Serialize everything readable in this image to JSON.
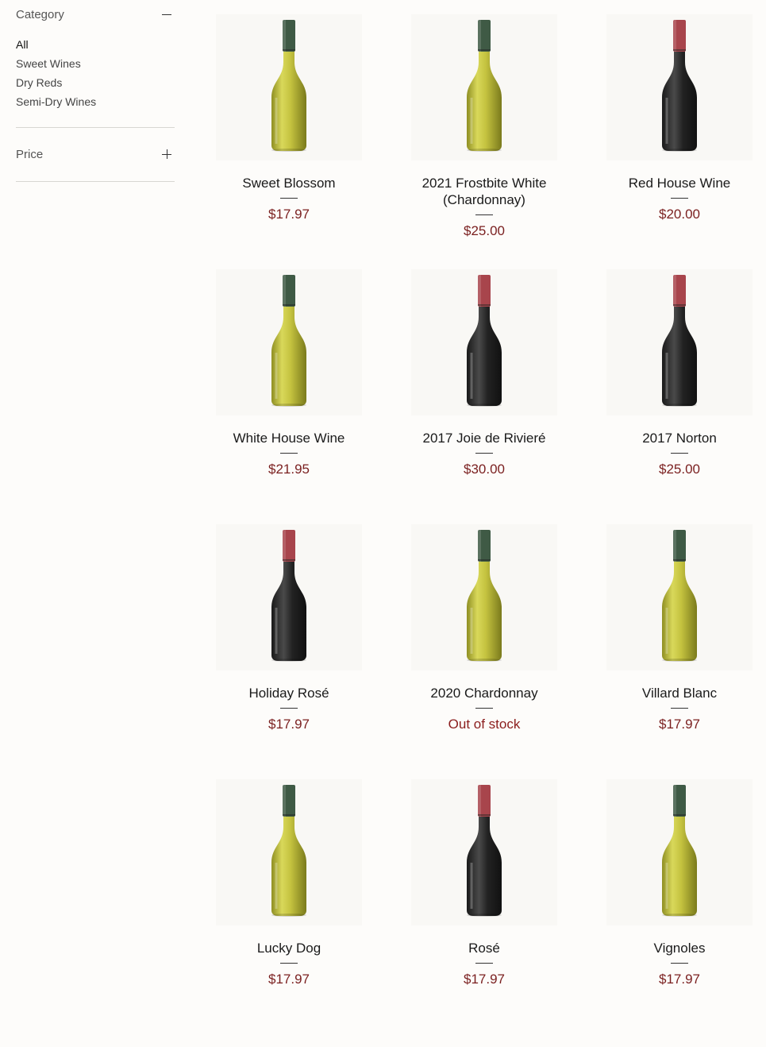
{
  "sidebar": {
    "category_title": "Category",
    "categories": [
      "All",
      "Sweet Wines",
      "Dry Reds",
      "Semi-Dry Wines"
    ],
    "price_title": "Price"
  },
  "colors": {
    "price": "#7a1f1f",
    "white_capsule": "#3f5a45",
    "red_capsule": "#a8454c",
    "white_glass": "#c8c64a",
    "red_glass": "#2a2a2a"
  },
  "products": [
    {
      "name": "Sweet Blossom",
      "price": "$17.97",
      "bottle": "white"
    },
    {
      "name": "2021 Frostbite White (Chardonnay)",
      "price": "$25.00",
      "bottle": "white"
    },
    {
      "name": "Red House Wine",
      "price": "$20.00",
      "bottle": "red"
    },
    {
      "name": "White House Wine",
      "price": "$21.95",
      "bottle": "white"
    },
    {
      "name": "2017 Joie de Rivieré",
      "price": "$30.00",
      "bottle": "red"
    },
    {
      "name": "2017 Norton",
      "price": "$25.00",
      "bottle": "red"
    },
    {
      "name": "Holiday Rosé",
      "price": "$17.97",
      "bottle": "red"
    },
    {
      "name": "2020 Chardonnay",
      "price": "Out of stock",
      "bottle": "white"
    },
    {
      "name": "Villard Blanc",
      "price": "$17.97",
      "bottle": "white"
    },
    {
      "name": "Lucky Dog",
      "price": "$17.97",
      "bottle": "white"
    },
    {
      "name": "Rosé",
      "price": "$17.97",
      "bottle": "red"
    },
    {
      "name": "Vignoles",
      "price": "$17.97",
      "bottle": "white"
    }
  ]
}
